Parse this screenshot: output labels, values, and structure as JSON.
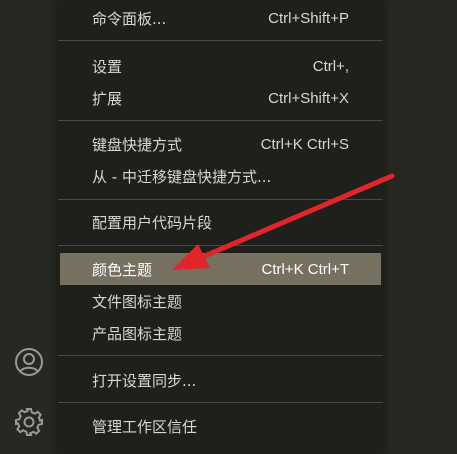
{
  "menu": {
    "groups": [
      {
        "items": [
          {
            "label": "命令面板...",
            "shortcut": "Ctrl+Shift+P"
          }
        ]
      },
      {
        "items": [
          {
            "label": "设置",
            "shortcut": "Ctrl+,"
          },
          {
            "label": "扩展",
            "shortcut": "Ctrl+Shift+X"
          }
        ]
      },
      {
        "items": [
          {
            "label": "键盘快捷方式",
            "shortcut": "Ctrl+K Ctrl+S"
          },
          {
            "label": "从 - 中迁移键盘快捷方式...",
            "shortcut": ""
          }
        ]
      },
      {
        "items": [
          {
            "label": "配置用户代码片段",
            "shortcut": ""
          }
        ]
      },
      {
        "items": [
          {
            "label": "颜色主题",
            "shortcut": "Ctrl+K Ctrl+T",
            "highlighted": true
          },
          {
            "label": "文件图标主题",
            "shortcut": ""
          },
          {
            "label": "产品图标主题",
            "shortcut": ""
          }
        ]
      },
      {
        "items": [
          {
            "label": "打开设置同步...",
            "shortcut": ""
          }
        ]
      },
      {
        "items": [
          {
            "label": "管理工作区信任",
            "shortcut": ""
          }
        ]
      }
    ]
  },
  "activity_bar": {
    "icons": [
      "account-icon",
      "gear-icon"
    ]
  },
  "colors": {
    "menu_background": "#1f1f1c",
    "highlight": "#767061",
    "annotation_arrow": "#e0262a"
  }
}
